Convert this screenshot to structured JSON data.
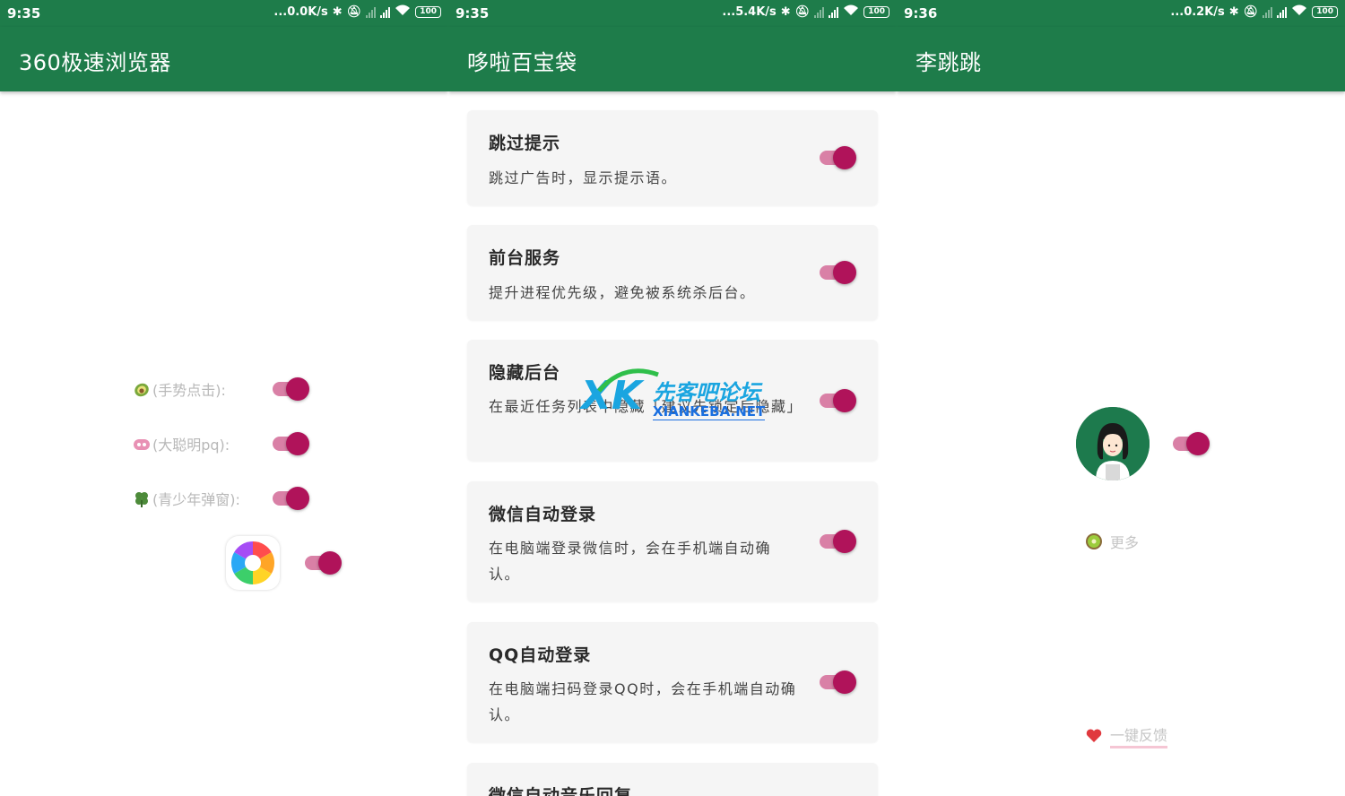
{
  "status_bars": [
    {
      "time": "9:35",
      "speed": "...0.0K/s"
    },
    {
      "time": "9:35",
      "speed": "...5.4K/s"
    },
    {
      "time": "9:36",
      "speed": "...0.2K/s"
    }
  ],
  "battery_level": "100",
  "panel1": {
    "title": "360极速浏览器",
    "rows": [
      {
        "label": "(手势点击):",
        "icon": "avocado-icon",
        "enabled": true
      },
      {
        "label": "(大聪明pq):",
        "icon": "pig-face-icon",
        "enabled": true
      },
      {
        "label": "(青少年弹窗):",
        "icon": "clover-icon",
        "enabled": true
      }
    ],
    "app_toggle_enabled": true,
    "app_icon": "360-browser-icon"
  },
  "panel2": {
    "title": "哆啦百宝袋",
    "cards": [
      {
        "title": "跳过提示",
        "desc": "跳过广告时，显示提示语。",
        "enabled": true
      },
      {
        "title": "前台服务",
        "desc": "提升进程优先级，避免被系统杀后台。",
        "enabled": true
      },
      {
        "title": "隐藏后台",
        "desc": "在最近任务列表中隐藏「建议先锁定后隐藏」",
        "enabled": true
      },
      {
        "title": "微信自动登录",
        "desc": "在电脑端登录微信时，会在手机端自动确认。",
        "enabled": true
      },
      {
        "title": "QQ自动登录",
        "desc": "在电脑端扫码登录QQ时，会在手机端自动确认。",
        "enabled": true
      },
      {
        "title": "微信自动音乐回复",
        "desc": "",
        "enabled": true
      }
    ],
    "watermark": {
      "logo": "XK",
      "name": "先客吧论坛",
      "site": "XIANKEBA.NET"
    }
  },
  "panel3": {
    "title": "李跳跳",
    "avatar": "girl-avatar-icon",
    "toggle_enabled": true,
    "more_label": "更多",
    "more_icon": "kiwi-icon",
    "feedback_label": "一键反馈",
    "feedback_icon": "heart-icon"
  },
  "colors": {
    "appbar": "#1e7c4a",
    "toggle_thumb": "#b0135a",
    "toggle_track": "#d980a6",
    "card_bg": "#f5f5f5"
  }
}
